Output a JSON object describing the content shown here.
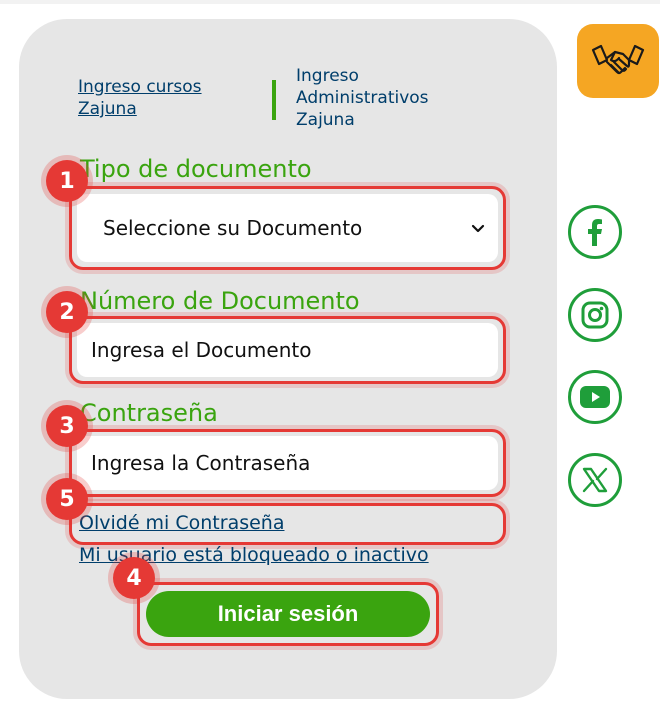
{
  "nav": {
    "courses_link": "Ingreso cursos Zajuna",
    "admin_text": "Ingreso Administrativos Zajuna"
  },
  "form": {
    "doc_type_label": "Tipo de documento",
    "doc_type_selected": "Seleccione su Documento",
    "doc_number_label": "Número de Documento",
    "doc_number_placeholder": "Ingresa el Documento",
    "password_label": "Contraseña",
    "password_placeholder": "Ingresa la Contraseña",
    "forgot_password_link": "Olvidé mi Contraseña",
    "blocked_user_link": "Mi usuario está bloqueado o inactivo",
    "submit_label": "Iniciar sesión"
  },
  "annotations": [
    "1",
    "2",
    "3",
    "4",
    "5"
  ],
  "social": [
    "facebook-icon",
    "instagram-icon",
    "youtube-icon",
    "x-icon"
  ],
  "colors": {
    "accent_green": "#3aa40f",
    "link_blue": "#003e6b",
    "annotation_red": "#e53935",
    "social_green": "#1f9e3a",
    "help_orange": "#f5a623",
    "card_gray": "#e6e6e6"
  }
}
